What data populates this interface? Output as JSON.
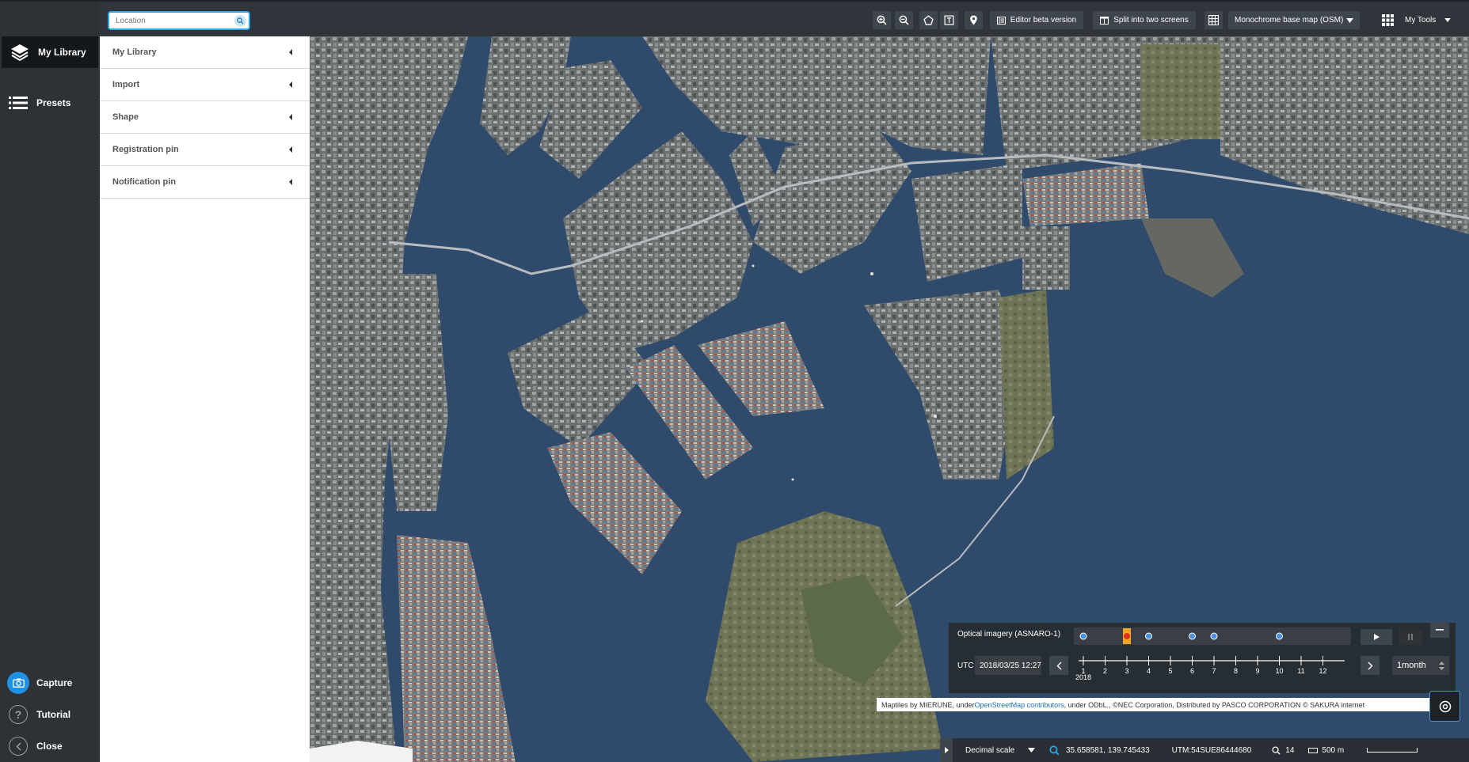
{
  "search": {
    "placeholder": "Location"
  },
  "toolbar": {
    "editor_label": "Editor beta version",
    "split_label": "Split into two screens",
    "basemap_label": "Monochrome base map (OSM)",
    "tools_label": "My Tools"
  },
  "leftnav": {
    "my_library": "My Library",
    "presets": "Presets",
    "capture": "Capture",
    "tutorial": "Tutorial",
    "close": "Close"
  },
  "panel": {
    "items": [
      {
        "label": "My Library"
      },
      {
        "label": "Import"
      },
      {
        "label": "Shape"
      },
      {
        "label": "Registration pin"
      },
      {
        "label": "Notification pin"
      }
    ]
  },
  "timeline": {
    "layer_name": "Optical imagery (ASNARO-1)",
    "utc_label": "UTC",
    "datetime": "2018/03/25 12:27",
    "year": "2018",
    "months": [
      "1",
      "2",
      "3",
      "4",
      "5",
      "6",
      "7",
      "8",
      "9",
      "10",
      "11",
      "12"
    ],
    "markers": [
      1,
      3,
      4,
      6,
      7,
      10
    ],
    "selected_month": 3,
    "interval": "1month"
  },
  "attribution": {
    "prefix": "Maptiles by MIERUNE, under ",
    "link": "OpenStreetMap contributors",
    "suffix": ", under ODbL., ©NEC Corporation, Distributed by PASCO CORPORATION © SAKURA internet"
  },
  "status": {
    "scale_mode": "Decimal scale",
    "coords": "35.658581, 139.745433",
    "utm": "UTM:54SUE86444680",
    "zoom": "14",
    "scale": "500 m"
  },
  "colors": {
    "accent": "#26a7e9",
    "sea": "#2f4a6b",
    "marker": "#4a90e2",
    "selected": "#f5a623"
  }
}
